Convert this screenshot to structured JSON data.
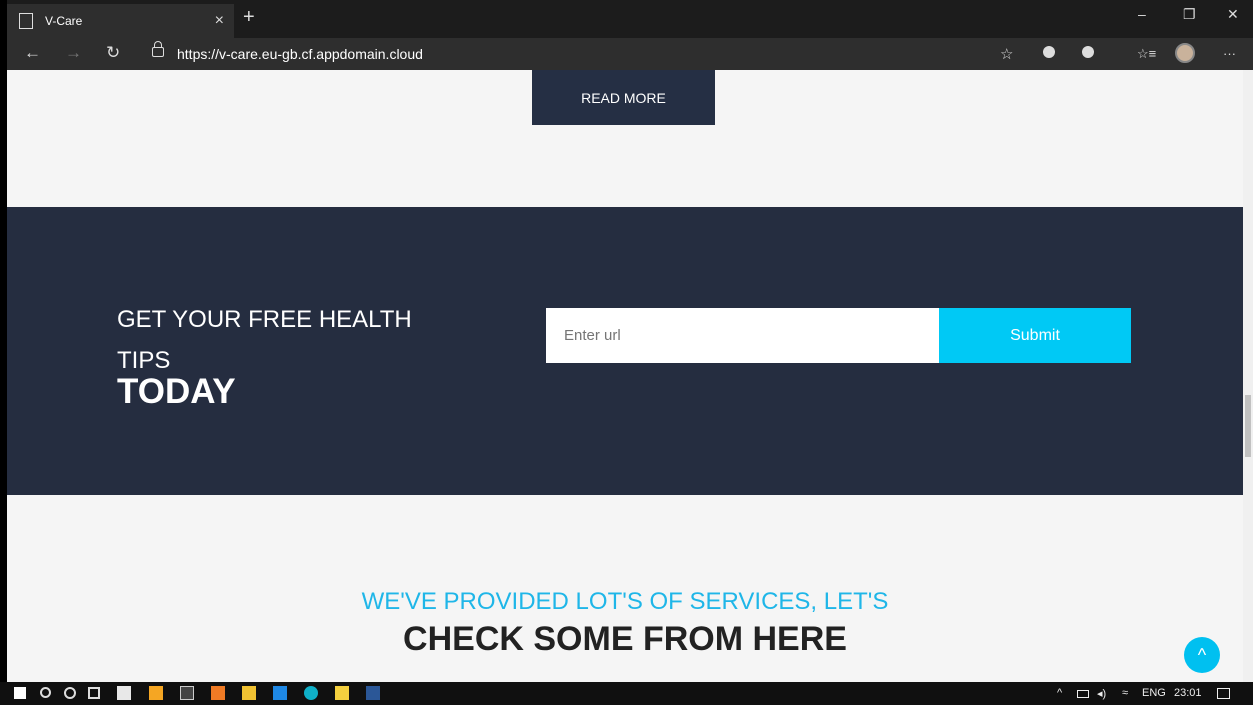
{
  "browser": {
    "tab_title": "V-Care",
    "tab_close": "×",
    "new_tab": "+",
    "url": "https://v-care.eu-gb.cf.appdomain.cloud",
    "win_min": "–",
    "win_max": "❐",
    "win_close": "✕",
    "back": "←",
    "forward": "→",
    "refresh": "↻",
    "favorite": "☆",
    "favorites": "☆≡",
    "more": "···"
  },
  "page": {
    "read_more": "READ MORE",
    "cta_line1": "GET YOUR FREE HEALTH TIPS",
    "cta_line2": "TODAY",
    "input_placeholder": "Enter url",
    "submit_label": "Submit",
    "services_sub": "WE'VE PROVIDED LOT'S OF SERVICES, LET'S",
    "services_title": "CHECK SOME FROM HERE",
    "back_to_top": "^"
  },
  "taskbar": {
    "language": "ENG",
    "time": "23:01"
  },
  "colors": {
    "navy": "#252d40",
    "accent": "#00c9f5"
  }
}
